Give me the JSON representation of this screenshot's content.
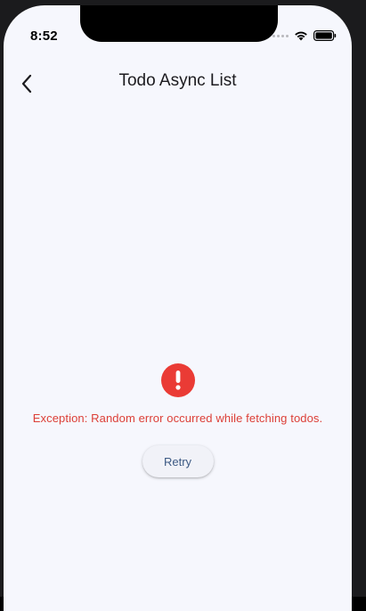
{
  "status_bar": {
    "time": "8:52"
  },
  "app_bar": {
    "title": "Todo Async List",
    "back_icon": "chevron-left-icon"
  },
  "error": {
    "icon": "exclamation-circle-icon",
    "icon_color": "#EA3B35",
    "message": "Exception: Random error occurred while fetching todos.",
    "message_color": "#DC3F37"
  },
  "retry_button": {
    "label": "Retry",
    "text_color": "#3D5A84"
  },
  "colors": {
    "screen_background": "#F6F7FD",
    "device_frame": "#1B1B1D"
  }
}
